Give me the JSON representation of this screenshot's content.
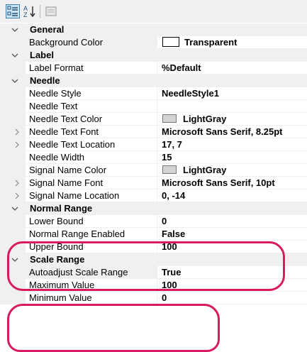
{
  "toolbar": {
    "categorized_icon": "categorized-icon",
    "alphabetical_icon": "alphabetical-icon",
    "property_pages_icon": "property-pages-icon"
  },
  "categories": {
    "general": "General",
    "label": "Label",
    "needle": "Needle",
    "normal_range": "Normal Range",
    "scale_range": "Scale Range"
  },
  "props": {
    "background_color": {
      "name": "Background Color",
      "value": "Transparent",
      "swatch": "#ffffff"
    },
    "label_format": {
      "name": "Label Format",
      "value": "%Default"
    },
    "needle_style": {
      "name": "Needle Style",
      "value": "NeedleStyle1"
    },
    "needle_text": {
      "name": "Needle Text",
      "value": ""
    },
    "needle_text_color": {
      "name": "Needle Text Color",
      "value": "LightGray",
      "swatch": "#d3d3d3"
    },
    "needle_text_font": {
      "name": "Needle Text Font",
      "value": "Microsoft Sans Serif, 8.25pt"
    },
    "needle_text_location": {
      "name": "Needle Text Location",
      "value": "17, 7"
    },
    "needle_width": {
      "name": "Needle Width",
      "value": "15"
    },
    "signal_name_color": {
      "name": "Signal Name Color",
      "value": "LightGray",
      "swatch": "#d3d3d3"
    },
    "signal_name_font": {
      "name": "Signal Name Font",
      "value": "Microsoft Sans Serif, 10pt"
    },
    "signal_name_location": {
      "name": "Signal Name Location",
      "value": "0, -14"
    },
    "lower_bound": {
      "name": "Lower Bound",
      "value": "0"
    },
    "normal_range_enabled": {
      "name": "Normal Range Enabled",
      "value": "False"
    },
    "upper_bound": {
      "name": "Upper Bound",
      "value": "100"
    },
    "autoadjust_scale_range": {
      "name": "Autoadjust Scale Range",
      "value": "True"
    },
    "maximum_value": {
      "name": "Maximum Value",
      "value": "100"
    },
    "minimum_value": {
      "name": "Minimum Value",
      "value": "0"
    }
  },
  "colors": {
    "highlight": "#d81b60",
    "selection": "#cce4f7",
    "category_bg": "#f0f0f0"
  }
}
